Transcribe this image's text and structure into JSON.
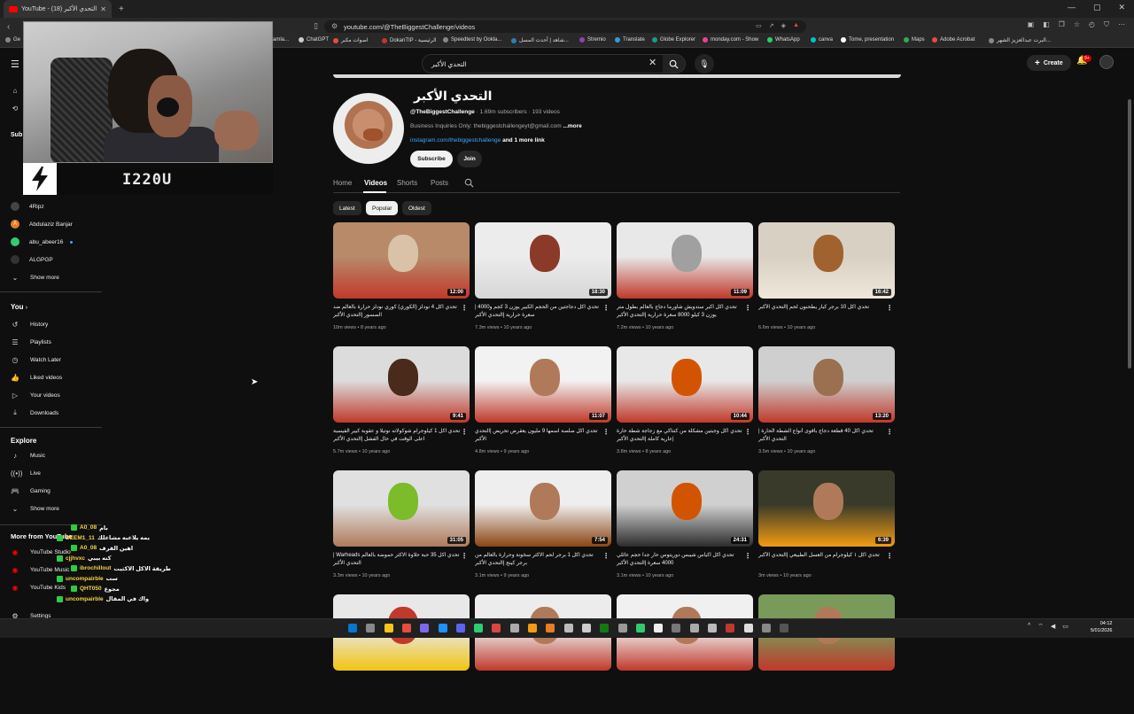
{
  "browser": {
    "tab_title": "YouTube - التحدي الأكبر (18)",
    "url": "youtube.com/@TheBiggestChallenge/videos",
    "bookmarks": [
      "Ge",
      "amla...",
      "ChatGPT",
      "اصوات مكبر",
      "DokanTIP - الرئيسية",
      "Speedtest by Ookla...",
      "شاهد | أحدث المسل...",
      "Stremio",
      "Translate",
      "Globe Explorer",
      "monday.com - Show",
      "WhatsApp",
      "canva",
      "Tome, presentation",
      "Maps",
      "Adobe Acrobat",
      "البرت عبدالعزيز الشهر..."
    ]
  },
  "youtube": {
    "search_query": "التحدي الأكبر",
    "create_label": "Create",
    "notif_count": "9+"
  },
  "sidebar": {
    "subs_head": "Sub",
    "subs": [
      {
        "name": "4Ripz",
        "color": "#444444",
        "letter": ""
      },
      {
        "name": "Abdulaziz Banjar",
        "color": "#e67e22",
        "letter": "A"
      },
      {
        "name": "abu_abeer16",
        "color": "#2ecc71",
        "letter": ""
      },
      {
        "name": "ALGPGP",
        "color": "#333333",
        "letter": ""
      }
    ],
    "show_more_1": "Show more",
    "you_head": "You",
    "you_items": [
      "History",
      "Playlists",
      "Watch Later",
      "Liked videos",
      "Your videos",
      "Downloads"
    ],
    "explore_head": "Explore",
    "explore_items": [
      "Music",
      "Live",
      "Gaming",
      "Show more"
    ],
    "more_head": "More from YouTube",
    "more_items": [
      "YouTube Studio",
      "YouTube Music",
      "YouTube Kids",
      "Settings"
    ]
  },
  "stream": {
    "name": "I220U"
  },
  "channel": {
    "name": "التحدي الأكبر",
    "handle": "@TheBiggestChallenge",
    "stats": "1.69m subscribers · 193 videos",
    "description": "Business Inquiries Only: thebiggestchallengeyt@gmail.com",
    "more_label": "...more",
    "link": "instagram.com/thebiggestchallenge",
    "link_more": "and 1 more link",
    "subscribe_label": "Subscribe",
    "join_label": "Join",
    "tabs": [
      "Home",
      "Videos",
      "Shorts",
      "Posts"
    ],
    "chips": [
      "Latest",
      "Popular",
      "Oldest"
    ]
  },
  "videos": [
    {
      "title": "تحدي اكل 4 نودلز (الكوري) كوري نودلز حرارة بالعالم ضد الصسور |التحدي الأكبر",
      "duration": "12:00",
      "views": "10m views",
      "age": "8 years ago"
    },
    {
      "title": "تحدي اكل دجاجتين من الحجم الكبير يوزن 3 كجم و4000 |سعرة حرارية |التحدي الأكبر",
      "duration": "18:30",
      "views": "7.3m views",
      "age": "10 years ago"
    },
    {
      "title": "تحدي اكل اكبر سندويش شاورما دجاج بالعالم بطول متر يوزن 3 كيلو 8000 سعرة حرارية |التحدي الأكبر",
      "duration": "11:09",
      "views": "7.2m views",
      "age": "10 years ago"
    },
    {
      "title": "تحدي اكل 10 برجر كبار يطحنون لحم |التحدي الأكبر",
      "duration": "16:42",
      "views": "6.6m views",
      "age": "10 years ago"
    },
    {
      "title": "تحدي اكل 1 كيلوجرام شوكولاته نوتيلا و عقوبة كبير الفيسبة اعلى الوقت في حال الفشل |التحدي الأكبر",
      "duration": "9:41",
      "views": "5.7m views",
      "age": "10 years ago"
    },
    {
      "title": "تحدي اكل صلصة اسمها 9 مليون يعقرض تحريض |التحدي الأكبر",
      "duration": "11:07",
      "views": "4.8m views",
      "age": "9 years ago"
    },
    {
      "title": "تحدي اكل وجبتين مشكلة من كنتاكي مع زجاجة شطة حارة |عارية كاملة |التحدي الأكبر",
      "duration": "10:44",
      "views": "3.8m views",
      "age": "8 years ago"
    },
    {
      "title": "تحدي اكل 40 قطعة دجاج بأقوى أنواع الشطة الحارة |التحدي الأكبر",
      "duration": "13:20",
      "views": "3.5m views",
      "age": "10 years ago"
    },
    {
      "title": "تحدي اكل 35 حبة حلاوة الاكثر حموضة بالعالم Warheads |التحدي الأكبر",
      "duration": "31:05",
      "views": "3.3m views",
      "age": "10 years ago"
    },
    {
      "title": "تحدي اكل 1 برجر لحم الاكثر سخونة وحرارة بالعالم من برجر كينج |التحدي الأكبر",
      "duration": "7:54",
      "views": "3.1m views",
      "age": "9 years ago"
    },
    {
      "title": "تحدي اكل اكياس شيبس دوريتوس حار جدا حجم عائلي 4000 سعرة |التحدي الأكبر",
      "duration": "24:31",
      "views": "3.1m views",
      "age": "10 years ago"
    },
    {
      "title": "تحدي اكل ١ كيلوجرام من العسل الطبيعي |التحدي الأكبر",
      "duration": "6:39",
      "views": "3m views",
      "age": "10 years ago"
    },
    {
      "title": "",
      "duration": "",
      "views": "",
      "age": ""
    },
    {
      "title": "",
      "duration": "",
      "views": "",
      "age": ""
    },
    {
      "title": "",
      "duration": "",
      "views": "",
      "age": ""
    },
    {
      "title": "",
      "duration": "",
      "views": "",
      "age": ""
    }
  ],
  "chat": [
    {
      "user": "A0_08",
      "msg": "بام"
    },
    {
      "user": "DEEM1_11",
      "msg": "يمه يلاعبه مشاعلك"
    },
    {
      "user": "A0_08",
      "msg": "اهين القرف"
    },
    {
      "user": "cjjhvxc",
      "msg": "كنه بيبي"
    },
    {
      "user": "ibrochillout",
      "msg": "طريقة الاكل الاكثيت"
    },
    {
      "user": "uncompairble",
      "msg": "سب"
    },
    {
      "user": "QHT050",
      "msg": "مجوع"
    },
    {
      "user": "uncompairble",
      "msg": "واك في المقال"
    }
  ],
  "taskbar": {
    "time": "04:12",
    "date": "5/01/2026"
  },
  "colors": {
    "bg": "#0f0f0f",
    "accent_link": "#3ea6ff",
    "youtube_red": "#ff0000",
    "chat_user": "#f5d442"
  }
}
